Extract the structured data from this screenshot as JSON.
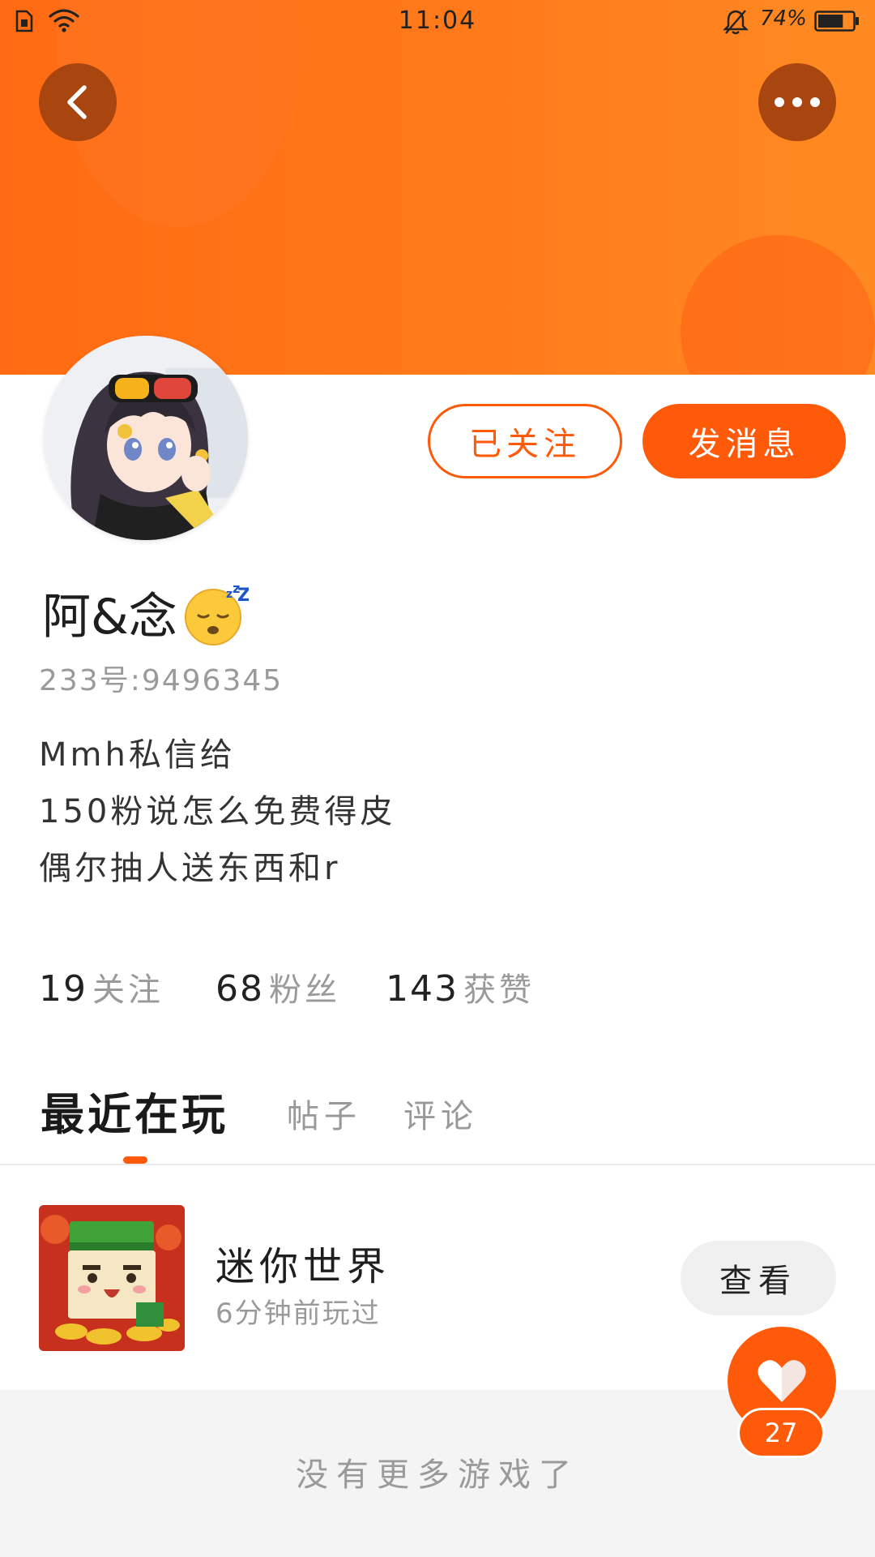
{
  "status_bar": {
    "time": "11:04",
    "battery_percent": "74%",
    "battery_level": 0.74,
    "icons": [
      "sim-icon",
      "wifi-icon",
      "bell-mute-icon",
      "battery-icon"
    ]
  },
  "header": {
    "back_icon": "back-arrow-icon",
    "more_icon": "more-dots-icon",
    "banner_colors": [
      "#ff6a12",
      "#ff8a22"
    ]
  },
  "profile": {
    "name": "阿&念",
    "name_emoji": "sleeping-face-emoji",
    "user_id": "233号:9496345",
    "bio": [
      "Mmh私信给",
      "150粉说怎么免费得皮",
      "偶尔抽人送东西和r"
    ],
    "followed_label": "已关注",
    "message_label": "发消息"
  },
  "stats": {
    "following_count": "19",
    "following_label": "关注",
    "fans_count": "68",
    "fans_label": "粉丝",
    "likes_count": "143",
    "likes_label": "获赞"
  },
  "tabs": [
    {
      "label": "最近在玩",
      "active": true
    },
    {
      "label": "帖子",
      "active": false
    },
    {
      "label": "评论",
      "active": false
    }
  ],
  "games": [
    {
      "title": "迷你世界",
      "played": "6分钟前玩过",
      "action_label": "查看"
    }
  ],
  "footer": {
    "no_more": "没有更多游戏了"
  },
  "like_fab": {
    "icon": "heart-icon",
    "count": "27"
  },
  "colors": {
    "accent": "#ff5a0a",
    "secondary_text": "#9a9a9a",
    "button_gray": "#f0f0f0"
  }
}
